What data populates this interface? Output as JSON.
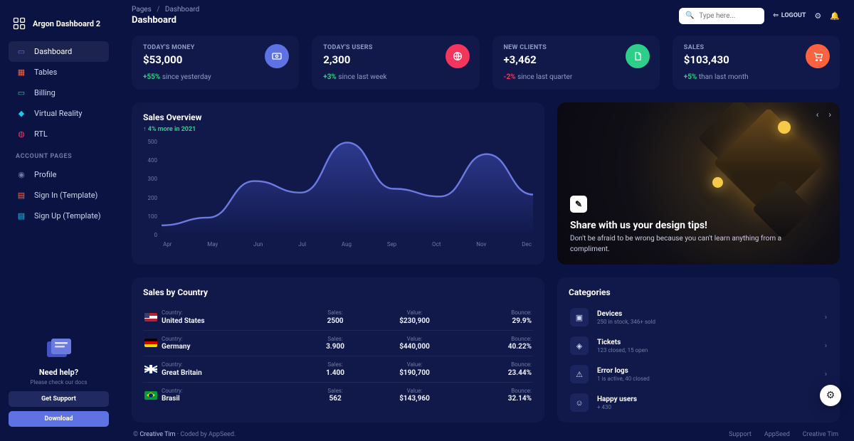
{
  "brand": "Argon Dashboard 2",
  "sidebar": {
    "items": [
      {
        "label": "Dashboard"
      },
      {
        "label": "Tables"
      },
      {
        "label": "Billing"
      },
      {
        "label": "Virtual Reality"
      },
      {
        "label": "RTL"
      }
    ],
    "section_label": "ACCOUNT PAGES",
    "account_items": [
      {
        "label": "Profile"
      },
      {
        "label": "Sign In (Template)"
      },
      {
        "label": "Sign Up (Template)"
      }
    ],
    "help": {
      "title": "Need help?",
      "sub": "Please check our docs",
      "btn_support": "Get Support",
      "btn_download": "Download"
    }
  },
  "breadcrumbs": {
    "root": "Pages",
    "current": "Dashboard",
    "heading": "Dashboard"
  },
  "search": {
    "placeholder": "Type here..."
  },
  "topbar": {
    "logout": "LOGOUT"
  },
  "stats": [
    {
      "label": "TODAY'S MONEY",
      "value": "$53,000",
      "delta": "+55%",
      "delta_dir": "up",
      "delta_text": "since yesterday",
      "icon_bg": "#5e72e4",
      "icon": "money-icon"
    },
    {
      "label": "TODAY'S USERS",
      "value": "2,300",
      "delta": "+3%",
      "delta_dir": "up",
      "delta_text": "since last week",
      "icon_bg": "#f5365c",
      "icon": "globe-icon"
    },
    {
      "label": "NEW CLIENTS",
      "value": "+3,462",
      "delta": "-2%",
      "delta_dir": "down",
      "delta_text": "since last quarter",
      "icon_bg": "#2dce89",
      "icon": "doc-icon"
    },
    {
      "label": "SALES",
      "value": "$103,430",
      "delta": "+5%",
      "delta_dir": "up",
      "delta_text": "than last month",
      "icon_bg": "#fb6340",
      "icon": "cart-icon"
    }
  ],
  "overview": {
    "title": "Sales Overview",
    "badge_arrow": "↑",
    "badge_text": "4% more in 2021"
  },
  "chart_data": {
    "type": "line",
    "categories": [
      "Apr",
      "May",
      "Jun",
      "Jul",
      "Aug",
      "Sep",
      "Oct",
      "Nov",
      "Dec"
    ],
    "values": [
      50,
      90,
      280,
      220,
      480,
      240,
      200,
      420,
      210
    ],
    "ylim": [
      0,
      500
    ],
    "y_ticks": [
      500,
      400,
      300,
      200,
      100,
      0
    ]
  },
  "carousel": {
    "title": "Share with us your design tips!",
    "sub": "Don't be afraid to be wrong because you can't learn anything from a compliment."
  },
  "sales_by_country": {
    "title": "Sales by Country",
    "columns": {
      "country": "Country:",
      "sales": "Sales:",
      "value": "Value:",
      "bounce": "Bounce:"
    },
    "rows": [
      {
        "flag": "us",
        "country": "United States",
        "sales": "2500",
        "value": "$230,900",
        "bounce": "29.9%"
      },
      {
        "flag": "de",
        "country": "Germany",
        "sales": "3.900",
        "value": "$440,000",
        "bounce": "40.22%"
      },
      {
        "flag": "gb",
        "country": "Great Britain",
        "sales": "1.400",
        "value": "$190,700",
        "bounce": "23.44%"
      },
      {
        "flag": "br",
        "country": "Brasil",
        "sales": "562",
        "value": "$143,960",
        "bounce": "32.14%"
      }
    ]
  },
  "categories": {
    "title": "Categories",
    "items": [
      {
        "title": "Devices",
        "sub": "250 in stock, 346+ sold"
      },
      {
        "title": "Tickets",
        "sub": "123 closed, 15 open"
      },
      {
        "title": "Error logs",
        "sub": "1 is active, 40 closed"
      },
      {
        "title": "Happy users",
        "sub": "+ 430"
      }
    ]
  },
  "footer": {
    "copyright_pre": "© ",
    "brand": "Creative Tim",
    "rest": " · Coded by AppSeed.",
    "links": [
      "Support",
      "AppSeed",
      "Creative Tim"
    ]
  }
}
